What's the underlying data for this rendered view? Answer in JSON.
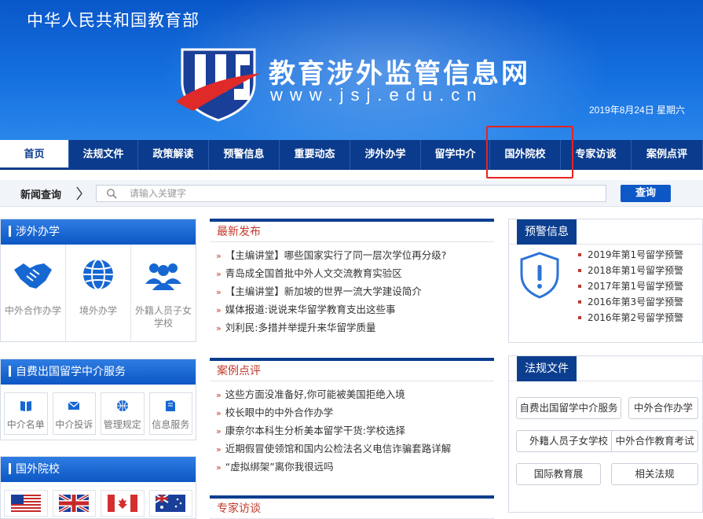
{
  "header": {
    "ministry": "中华人民共和国教育部",
    "site_title": "教育涉外监管信息网",
    "site_url": "www.jsj.edu.cn",
    "date": "2019年8月24日  星期六"
  },
  "nav": {
    "items": [
      "首页",
      "法规文件",
      "政策解读",
      "预警信息",
      "重要动态",
      "涉外办学",
      "留学中介",
      "国外院校",
      "专家访谈",
      "案例点评"
    ],
    "active_index": 0,
    "highlighted_index": 7
  },
  "search": {
    "label": "新闻查询",
    "placeholder": "请输入关键字",
    "button": "查询"
  },
  "left": {
    "foreign_school": {
      "title": "涉外办学",
      "items": [
        "中外合作办学",
        "境外办学",
        "外籍人员子女学校"
      ]
    },
    "agency": {
      "title": "自费出国留学中介服务",
      "items": [
        "中介名单",
        "中介投诉",
        "管理规定",
        "信息服务"
      ]
    },
    "universities": {
      "title": "国外院校",
      "flags": [
        "us-flag-icon",
        "uk-flag-icon",
        "canada-flag-icon",
        "australia-flag-icon"
      ]
    }
  },
  "middle": {
    "latest": {
      "title": "最新发布",
      "items": [
        "【主编讲堂】哪些国家实行了同一层次学位再分级?",
        "青岛成全国首批中外人文交流教育实验区",
        "【主编讲堂】新加坡的世界一流大学建设简介",
        "媒体报道:说说来华留学教育支出这些事",
        "刘利民:多措并举提升来华留学质量"
      ]
    },
    "cases": {
      "title": "案例点评",
      "items": [
        "这些方面没准备好,你可能被美国拒绝入境",
        "校长眼中的中外合作办学",
        "康奈尔本科生分析美本留学干货:学校选择",
        "近期假冒使领馆和国内公检法名义电信诈骗套路详解",
        "“虚拟绑架”离你我很远吗"
      ]
    },
    "interviews": {
      "title": "专家访谈"
    }
  },
  "right": {
    "warnings": {
      "title": "预警信息",
      "items": [
        "2019年第1号留学预警",
        "2018年第1号留学预警",
        "2017年第1号留学预警",
        "2016年第3号留学预警",
        "2016年第2号留学预警"
      ]
    },
    "regulations": {
      "title": "法规文件",
      "tags": [
        "自费出国留学中介服务",
        "中外合作办学",
        "外籍人员子女学校",
        "中外合作教育考试",
        "国际教育展",
        "相关法规"
      ]
    }
  },
  "colors": {
    "banner": "#1570df",
    "nav": "#0b3b8c",
    "accent_red": "#c0392b",
    "highlight_box": "#e8231f"
  }
}
